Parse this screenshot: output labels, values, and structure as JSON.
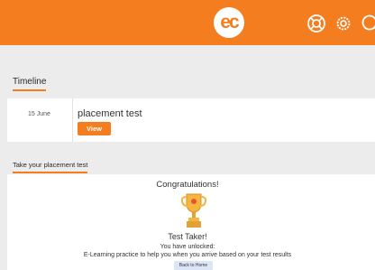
{
  "header": {
    "logo_text": "ec",
    "icons": [
      "lifebuoy-icon",
      "settings-gear-icon",
      "search-icon"
    ],
    "brand_color": "#f47d1f"
  },
  "timeline": {
    "heading": "Timeline",
    "items": [
      {
        "date": "15 June",
        "title": "placement test",
        "button_label": "View"
      }
    ]
  },
  "placement": {
    "heading": "Take your placement test",
    "congrats": "Congratulations!",
    "badge_icon": "trophy-icon",
    "badge_name": "Test Taker!",
    "unlock_line1": "You have unlocked:",
    "unlock_line2": "E-Learning practice to help you when you arrive based on your test results",
    "back_button": "Back to Home"
  }
}
